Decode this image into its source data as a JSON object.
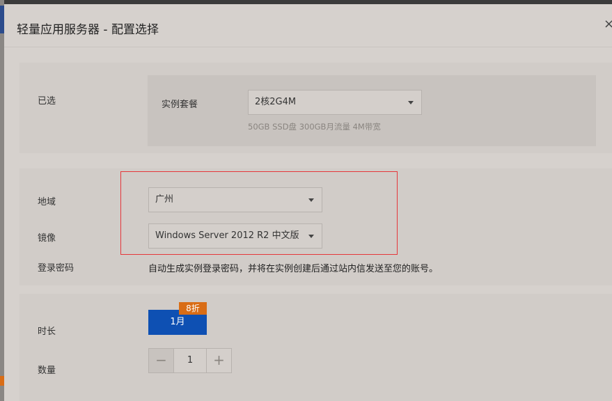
{
  "dialog": {
    "title": "轻量应用服务器 - 配置选择",
    "close_icon": "close-icon",
    "close_glyph": "×"
  },
  "selected": {
    "label": "已选",
    "plan_label": "实例套餐",
    "plan_value": "2核2G4M",
    "plan_hint": "50GB SSD盘 300GB月流量 4M带宽"
  },
  "region": {
    "label": "地域",
    "value": "广州"
  },
  "image": {
    "label": "镜像",
    "value": "Windows Server 2012 R2 中文版"
  },
  "password": {
    "label": "登录密码",
    "info": "自动生成实例登录密码，并将在实例创建后通过站内信发送至您的账号。"
  },
  "duration": {
    "label": "时长",
    "option": "1月",
    "badge": "8折",
    "option_color": "#0e50b3",
    "badge_color": "#d96d16"
  },
  "quantity": {
    "label": "数量",
    "minus": "−",
    "plus": "+",
    "value": "1"
  },
  "highlight_color": "#e5363a"
}
